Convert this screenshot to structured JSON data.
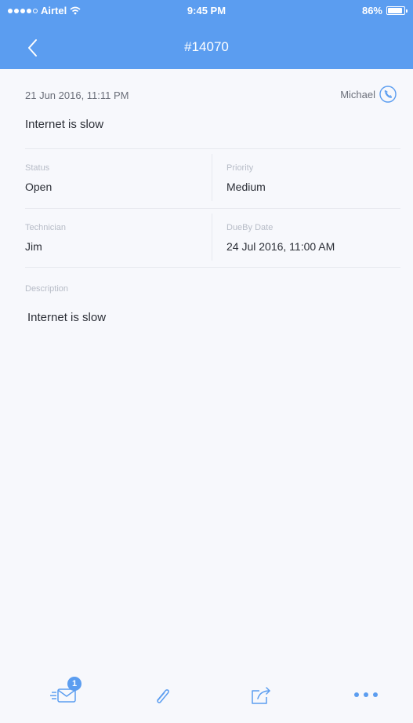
{
  "status_bar": {
    "carrier": "Airtel",
    "time": "9:45 PM",
    "battery": "86%"
  },
  "nav": {
    "title": "#14070",
    "back_icon": "chevron-left-icon"
  },
  "ticket": {
    "created": "21 Jun 2016, 11:11 PM",
    "requester": "Michael",
    "subject": "Internet is slow",
    "fields": {
      "status_label": "Status",
      "status_value": "Open",
      "priority_label": "Priority",
      "priority_value": "Medium",
      "technician_label": "Technician",
      "technician_value": "Jim",
      "dueby_label": "DueBy Date",
      "dueby_value": "24 Jul 2016, 11:00 AM"
    },
    "description_label": "Description",
    "description": "Internet is slow"
  },
  "toolbar": {
    "reply_badge": "1",
    "icons": [
      "reply-mail-icon",
      "attachment-icon",
      "share-icon",
      "more-icon"
    ]
  },
  "colors": {
    "accent": "#5b9df0",
    "background": "#f7f8fc",
    "text": "#2b2e36",
    "muted": "#6b6f7a",
    "label": "#b7bcc7"
  }
}
